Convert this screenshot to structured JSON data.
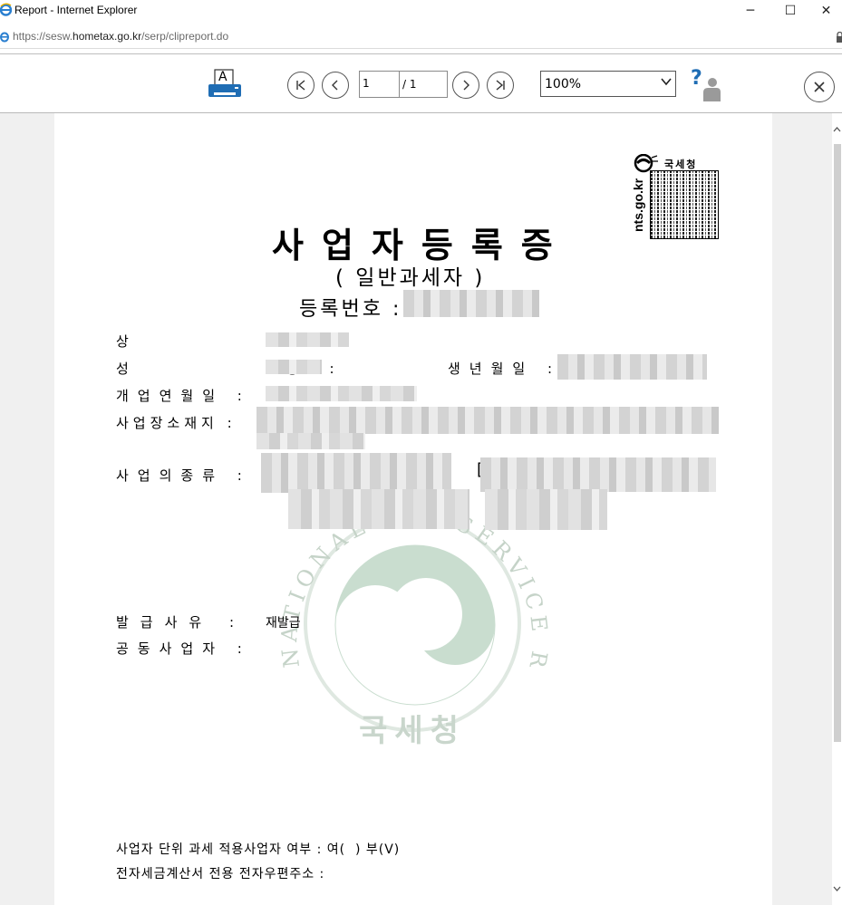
{
  "window": {
    "title": "Report - Internet Explorer",
    "url_host_prefix": "https://sesw.",
    "url_host": "hometax.go.kr",
    "url_path": "/serp/clipreport.do",
    "minimize": "─",
    "maximize": "☐",
    "close": "✕"
  },
  "toolbar": {
    "print_icon_letter": "A",
    "current_page": "1",
    "total_pages": "/ 1",
    "zoom": "100%",
    "help_glyph": "?"
  },
  "document": {
    "title": "사업자등록증",
    "subtitle": "( 일반과세자 )",
    "reg_label": "등록번호 :",
    "fields": {
      "trade_name_label": "상        호 :",
      "name_label": "성        명 :",
      "birth_label": "생년월일 :",
      "open_date_label": "개업연월일 :",
      "address_label": "사업장소재지 :",
      "business_type_label": "사업의종류 :",
      "business_type_bracket": "[",
      "issue_reason_label": "발급사유 :",
      "issue_reason_value": "재발급",
      "joint_label": "공동사업자 :"
    },
    "footer": {
      "unit_taxation": "사업자 단위 과세 적용사업자 여부 : 여(  ) 부(V)",
      "e_invoice": "전자세금계산서 전용 전자우편주소 :"
    },
    "nts": {
      "brand": "국세청",
      "domain": "nts.go.kr"
    },
    "seal": {
      "ring_text": "NATIONAL TAX SERVICE REPUBLIC OF KOREA",
      "center_text": "국세청"
    }
  },
  "colors": {
    "seal_green": "#c9ddcf",
    "printer_blue": "#1f6db4",
    "viewer_bg": "#f0f0f0"
  }
}
